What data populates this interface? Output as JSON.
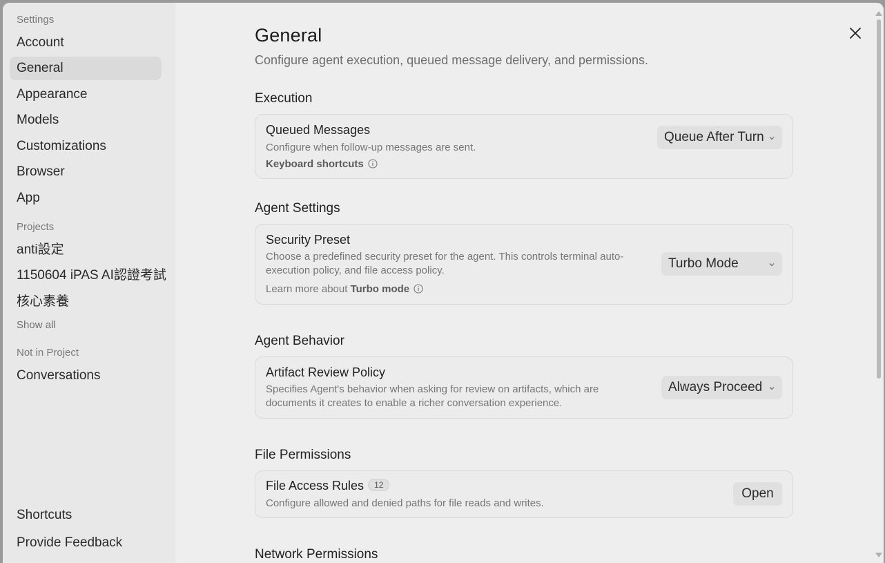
{
  "sidebar": {
    "settings_header": "Settings",
    "settings_items": [
      "Account",
      "General",
      "Appearance",
      "Models",
      "Customizations",
      "Browser",
      "App"
    ],
    "active_item": "General",
    "projects_header": "Projects",
    "projects": [
      "anti設定",
      "1150604 iPAS AI認證考試",
      "核心素養"
    ],
    "show_all": "Show all",
    "not_in_project_header": "Not in Project",
    "conversations": "Conversations",
    "shortcuts": "Shortcuts",
    "feedback": "Provide Feedback"
  },
  "header": {
    "title": "General",
    "subtitle": "Configure agent execution, queued message delivery, and permissions."
  },
  "execution": {
    "heading": "Execution",
    "title": "Queued Messages",
    "description": "Configure when follow-up messages are sent.",
    "link": "Keyboard shortcuts",
    "value": "Queue After Turn"
  },
  "agent_settings": {
    "heading": "Agent Settings",
    "title": "Security Preset",
    "description_line1": "Choose a predefined security preset for the agent. This controls terminal auto-",
    "description_line2": "execution policy, and file access policy.",
    "link_prefix": "Learn more about ",
    "link_bold": "Turbo mode",
    "value": "Turbo Mode"
  },
  "agent_behavior": {
    "heading": "Agent Behavior",
    "title": "Artifact Review Policy",
    "description_line1": "Specifies Agent's behavior when asking for review on artifacts, which are",
    "description_line2": "documents it creates to enable a richer conversation experience.",
    "value": "Always Proceed"
  },
  "file_permissions": {
    "heading": "File Permissions",
    "title": "File Access Rules",
    "count": "12",
    "description": "Configure allowed and denied paths for file reads and writes.",
    "button": "Open"
  },
  "network_permissions": {
    "heading": "Network Permissions"
  },
  "icons": {
    "close": "close-icon",
    "info": "info-icon",
    "chevron": "chevron-down-icon"
  }
}
